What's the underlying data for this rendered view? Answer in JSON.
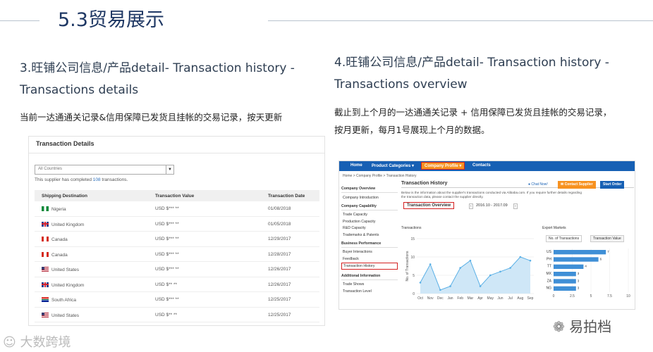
{
  "slide": {
    "title": "5.3贸易展示",
    "left_heading_line1": "3.旺铺公司信息/产品detail- Transaction history -",
    "left_heading_line2": "Transactions details",
    "left_desc": "当前一达通通关记录&信用保障已发货且挂帐的交易记录，按天更新",
    "right_heading_line1": "4.旺铺公司信息/产品detail- Transaction history -",
    "right_heading_line2": "Transactions overview",
    "right_desc_line1": "截止到上个月的一达通通关记录 + 信用保障已发货且挂帐的交易记录，",
    "right_desc_line2": "按月更新，每月1号展现上个月的数据。"
  },
  "watermark_left": "大数跨境",
  "watermark_right": "易拍档",
  "details": {
    "title": "Transaction Details",
    "select_value": "All Countries",
    "count_prefix": "This supplier has completed",
    "count_value": "108",
    "count_suffix": "transactions.",
    "columns": [
      "Shipping Destination",
      "Transaction Value",
      "Transaction Date"
    ],
    "rows": [
      {
        "flag": "ng",
        "country": "Nigeria",
        "value": "USD $*** **",
        "date": "01/08/2018"
      },
      {
        "flag": "uk",
        "country": "United Kingdom",
        "value": "USD $*** **",
        "date": "01/05/2018"
      },
      {
        "flag": "ca",
        "country": "Canada",
        "value": "USD $*** **",
        "date": "12/29/2017"
      },
      {
        "flag": "ca",
        "country": "Canada",
        "value": "USD $*** **",
        "date": "12/28/2017"
      },
      {
        "flag": "us",
        "country": "United States",
        "value": "USD $*** **",
        "date": "12/26/2017"
      },
      {
        "flag": "uk",
        "country": "United Kingdom",
        "value": "USD $** **",
        "date": "12/26/2017"
      },
      {
        "flag": "za",
        "country": "South Africa",
        "value": "USD $*** **",
        "date": "12/25/2017"
      },
      {
        "flag": "us",
        "country": "United States",
        "value": "USD $** **",
        "date": "12/25/2017"
      }
    ]
  },
  "overview": {
    "nav": [
      "Home",
      "Product Categories ▾",
      "Company Profile ▾",
      "Contacts"
    ],
    "nav_active": "Company Profile ▾",
    "breadcrumb": "Home > Company Profile > Transaction History",
    "sidebar": [
      {
        "section": "Company Overview",
        "items": [
          "Company Introduction"
        ]
      },
      {
        "section": "Company Capability",
        "items": [
          "Trade Capacity",
          "Production Capacity",
          "R&D Capacity",
          "Trademarks & Patents"
        ]
      },
      {
        "section": "Business Performance",
        "items": [
          "Buyer Interactions",
          "Feedback",
          "Transaction History"
        ]
      },
      {
        "section": "Additional Information",
        "items": [
          "Trade Shows",
          "Transaction Level"
        ]
      }
    ],
    "page_title": "Transaction History",
    "chat": "Chat Now!",
    "contact_btn": "Contact Supplier",
    "order_btn": "Start Order",
    "note_line1": "Below is the information about the supplier's transactions conducted via Alibaba.com. If you require further details regarding",
    "note_line2": "the transaction data, please contact the supplier directly.",
    "tab": "Transaction Overview",
    "range": "2016.10 - 2017.09",
    "chart_label": "Transactions",
    "export_label": "Export Markets",
    "tab_count": "No. of Transactions",
    "tab_value": "Transaction Value"
  },
  "chart_data": [
    {
      "type": "area",
      "title": "Transactions",
      "ylabel": "No. of Transactions",
      "x": [
        "Oct",
        "Nov",
        "Dec",
        "Jan",
        "Feb",
        "Mar",
        "Apr",
        "May",
        "Jun",
        "Jul",
        "Aug",
        "Sep"
      ],
      "values": [
        3,
        8,
        1,
        2,
        7,
        9,
        2,
        5,
        6,
        7,
        10,
        9
      ],
      "ylim": [
        0,
        15
      ],
      "yticks": [
        0,
        5,
        10,
        15
      ],
      "color": "#5bb0e6"
    },
    {
      "type": "bar",
      "title": "Export Markets",
      "categories": [
        "US",
        "PH",
        "TT",
        "MX",
        "ZA",
        "NG"
      ],
      "values": [
        7,
        6,
        4,
        3,
        3,
        3
      ],
      "xlim": [
        0,
        10
      ],
      "xticks": [
        0,
        2.5,
        5,
        7.5,
        10
      ],
      "color": "#3f8fd6"
    }
  ]
}
